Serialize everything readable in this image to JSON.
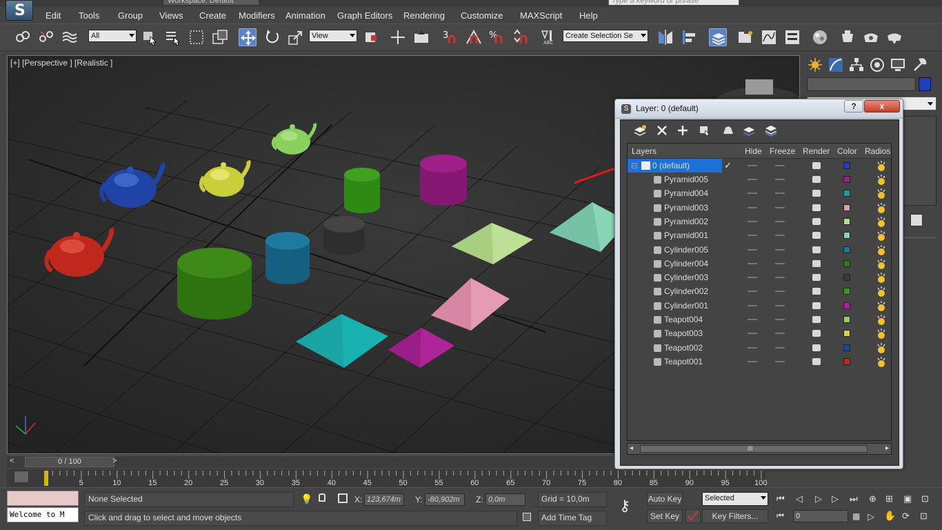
{
  "title_strip": {
    "workspace": "Workspace: Default",
    "search_placeholder": "Type a keyword or phrase"
  },
  "menu": [
    "Edit",
    "Tools",
    "Group",
    "Views",
    "Create",
    "Modifiers",
    "Animation",
    "Graph Editors",
    "Rendering",
    "Customize",
    "MAXScript",
    "Help"
  ],
  "toolbar": {
    "filter_select": "All",
    "ref_coord_select": "View",
    "named_selection": "Create Selection Se",
    "snap_labels": [
      "3",
      "%"
    ]
  },
  "viewport": {
    "label": "[+] [Perspective ] [Realistic ]"
  },
  "layer_dialog": {
    "title": "Layer: 0 (default)",
    "help_label": "?",
    "close_label": "x",
    "columns": [
      "Layers",
      "Hide",
      "Freeze",
      "Render",
      "Color",
      "Radiosi"
    ],
    "default_layer": "0 (default)",
    "objects": [
      {
        "name": "Pyramid005",
        "color": "#a0208a"
      },
      {
        "name": "Pyramid004",
        "color": "#1a9fa0"
      },
      {
        "name": "Pyramid003",
        "color": "#e59bb3"
      },
      {
        "name": "Pyramid002",
        "color": "#b5dd8a"
      },
      {
        "name": "Pyramid001",
        "color": "#86d2b2"
      },
      {
        "name": "Cylinder005",
        "color": "#1a7a9a"
      },
      {
        "name": "Cylinder004",
        "color": "#2e7d10"
      },
      {
        "name": "Cylinder003",
        "color": "#3a3a3a"
      },
      {
        "name": "Cylinder002",
        "color": "#3a9a1a"
      },
      {
        "name": "Cylinder001",
        "color": "#b01f9a"
      },
      {
        "name": "Teapot004",
        "color": "#8fd35c"
      },
      {
        "name": "Teapot003",
        "color": "#d3d64a"
      },
      {
        "name": "Teapot002",
        "color": "#1a44a8"
      },
      {
        "name": "Teapot001",
        "color": "#c02a1e"
      }
    ],
    "scroll_grip": "III"
  },
  "timeline": {
    "frame": "0 / 100",
    "ticks": [
      "5",
      "10",
      "15",
      "20",
      "25",
      "30",
      "35",
      "40",
      "45",
      "50",
      "55",
      "60",
      "65",
      "70",
      "75",
      "80",
      "85",
      "90",
      "95",
      "100"
    ]
  },
  "status": {
    "welcome": "Welcome to M",
    "selection": "None Selected",
    "prompt": "Click and drag to select and move objects",
    "x_label": "X:",
    "x_value": "123,674m",
    "y_label": "Y:",
    "y_value": "-80,902m",
    "z_label": "Z:",
    "z_value": "0,0m",
    "grid": "Grid = 10,0m",
    "add_time_tag": "Add Time Tag",
    "auto_key": "Auto Key",
    "set_key": "Set Key",
    "key_mode": "Selected",
    "key_filters": "Key Filters...",
    "current_frame": "0"
  }
}
